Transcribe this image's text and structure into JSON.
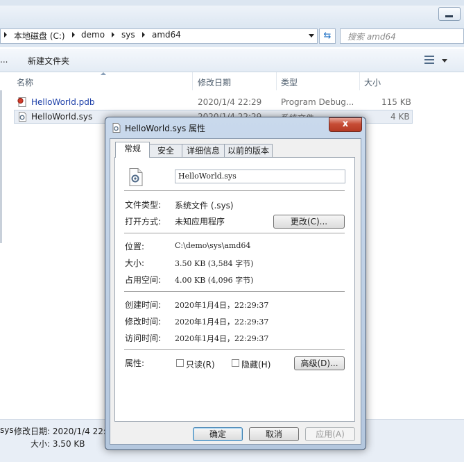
{
  "explorer": {
    "breadcrumb": [
      "本地磁盘 (C:)",
      "demo",
      "sys",
      "amd64"
    ],
    "search_placeholder": "搜索 amd64",
    "toolbar": {
      "ellipsis": "...",
      "new_folder": "新建文件夹"
    },
    "columns": {
      "name": "名称",
      "modified": "修改日期",
      "type": "类型",
      "size": "大小"
    },
    "files": [
      {
        "name": "HelloWorld.pdb",
        "modified": "2020/1/4 22:29",
        "type": "Program Debug...",
        "size": "115 KB"
      },
      {
        "name": "HelloWorld.sys",
        "modified": "2020/1/4 22:29",
        "type": "系统文件",
        "size": "4 KB"
      }
    ],
    "status": {
      "name": "sys",
      "modified": "修改日期: 2020/1/4 22:",
      "size": "大小: 3.50 KB"
    }
  },
  "dialog": {
    "title": "HelloWorld.sys 属性",
    "close": "x",
    "tabs": [
      "常规",
      "安全",
      "详细信息",
      "以前的版本"
    ],
    "filename": "HelloWorld.sys",
    "rows": {
      "file_type": {
        "label": "文件类型:",
        "value": "系统文件 (.sys)"
      },
      "open_with": {
        "label": "打开方式:",
        "value": "未知应用程序"
      },
      "location": {
        "label": "位置:",
        "value": "C:\\demo\\sys\\amd64"
      },
      "size": {
        "label": "大小:",
        "value": "3.50 KB (3,584 字节)"
      },
      "size_on_disk": {
        "label": "占用空间:",
        "value": "4.00 KB (4,096 字节)"
      },
      "created": {
        "label": "创建时间:",
        "value": "2020年1月4日，22:29:37"
      },
      "modified": {
        "label": "修改时间:",
        "value": "2020年1月4日，22:29:37"
      },
      "accessed": {
        "label": "访问时间:",
        "value": "2020年1月4日，22:29:37"
      },
      "attributes": {
        "label": "属性:"
      }
    },
    "change_button": "更改(C)...",
    "readonly_label": "只读(R)",
    "hidden_label": "隐藏(H)",
    "advanced_button": "高级(D)...",
    "ok_button": "确定",
    "cancel_button": "取消",
    "apply_button": "应用(A)"
  }
}
